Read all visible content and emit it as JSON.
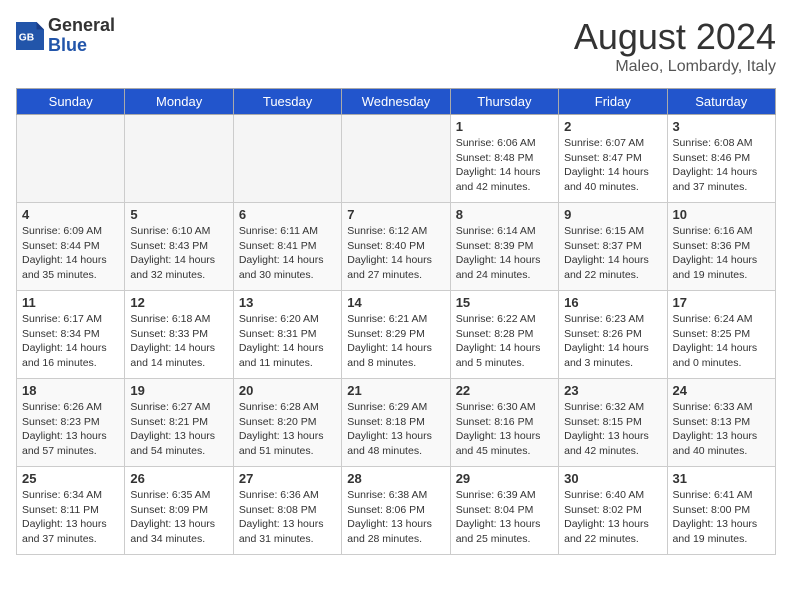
{
  "header": {
    "logo_general": "General",
    "logo_blue": "Blue",
    "month_year": "August 2024",
    "location": "Maleo, Lombardy, Italy"
  },
  "days_of_week": [
    "Sunday",
    "Monday",
    "Tuesday",
    "Wednesday",
    "Thursday",
    "Friday",
    "Saturday"
  ],
  "weeks": [
    [
      {
        "day": "",
        "info": ""
      },
      {
        "day": "",
        "info": ""
      },
      {
        "day": "",
        "info": ""
      },
      {
        "day": "",
        "info": ""
      },
      {
        "day": "1",
        "info": "Sunrise: 6:06 AM\nSunset: 8:48 PM\nDaylight: 14 hours\nand 42 minutes."
      },
      {
        "day": "2",
        "info": "Sunrise: 6:07 AM\nSunset: 8:47 PM\nDaylight: 14 hours\nand 40 minutes."
      },
      {
        "day": "3",
        "info": "Sunrise: 6:08 AM\nSunset: 8:46 PM\nDaylight: 14 hours\nand 37 minutes."
      }
    ],
    [
      {
        "day": "4",
        "info": "Sunrise: 6:09 AM\nSunset: 8:44 PM\nDaylight: 14 hours\nand 35 minutes."
      },
      {
        "day": "5",
        "info": "Sunrise: 6:10 AM\nSunset: 8:43 PM\nDaylight: 14 hours\nand 32 minutes."
      },
      {
        "day": "6",
        "info": "Sunrise: 6:11 AM\nSunset: 8:41 PM\nDaylight: 14 hours\nand 30 minutes."
      },
      {
        "day": "7",
        "info": "Sunrise: 6:12 AM\nSunset: 8:40 PM\nDaylight: 14 hours\nand 27 minutes."
      },
      {
        "day": "8",
        "info": "Sunrise: 6:14 AM\nSunset: 8:39 PM\nDaylight: 14 hours\nand 24 minutes."
      },
      {
        "day": "9",
        "info": "Sunrise: 6:15 AM\nSunset: 8:37 PM\nDaylight: 14 hours\nand 22 minutes."
      },
      {
        "day": "10",
        "info": "Sunrise: 6:16 AM\nSunset: 8:36 PM\nDaylight: 14 hours\nand 19 minutes."
      }
    ],
    [
      {
        "day": "11",
        "info": "Sunrise: 6:17 AM\nSunset: 8:34 PM\nDaylight: 14 hours\nand 16 minutes."
      },
      {
        "day": "12",
        "info": "Sunrise: 6:18 AM\nSunset: 8:33 PM\nDaylight: 14 hours\nand 14 minutes."
      },
      {
        "day": "13",
        "info": "Sunrise: 6:20 AM\nSunset: 8:31 PM\nDaylight: 14 hours\nand 11 minutes."
      },
      {
        "day": "14",
        "info": "Sunrise: 6:21 AM\nSunset: 8:29 PM\nDaylight: 14 hours\nand 8 minutes."
      },
      {
        "day": "15",
        "info": "Sunrise: 6:22 AM\nSunset: 8:28 PM\nDaylight: 14 hours\nand 5 minutes."
      },
      {
        "day": "16",
        "info": "Sunrise: 6:23 AM\nSunset: 8:26 PM\nDaylight: 14 hours\nand 3 minutes."
      },
      {
        "day": "17",
        "info": "Sunrise: 6:24 AM\nSunset: 8:25 PM\nDaylight: 14 hours\nand 0 minutes."
      }
    ],
    [
      {
        "day": "18",
        "info": "Sunrise: 6:26 AM\nSunset: 8:23 PM\nDaylight: 13 hours\nand 57 minutes."
      },
      {
        "day": "19",
        "info": "Sunrise: 6:27 AM\nSunset: 8:21 PM\nDaylight: 13 hours\nand 54 minutes."
      },
      {
        "day": "20",
        "info": "Sunrise: 6:28 AM\nSunset: 8:20 PM\nDaylight: 13 hours\nand 51 minutes."
      },
      {
        "day": "21",
        "info": "Sunrise: 6:29 AM\nSunset: 8:18 PM\nDaylight: 13 hours\nand 48 minutes."
      },
      {
        "day": "22",
        "info": "Sunrise: 6:30 AM\nSunset: 8:16 PM\nDaylight: 13 hours\nand 45 minutes."
      },
      {
        "day": "23",
        "info": "Sunrise: 6:32 AM\nSunset: 8:15 PM\nDaylight: 13 hours\nand 42 minutes."
      },
      {
        "day": "24",
        "info": "Sunrise: 6:33 AM\nSunset: 8:13 PM\nDaylight: 13 hours\nand 40 minutes."
      }
    ],
    [
      {
        "day": "25",
        "info": "Sunrise: 6:34 AM\nSunset: 8:11 PM\nDaylight: 13 hours\nand 37 minutes."
      },
      {
        "day": "26",
        "info": "Sunrise: 6:35 AM\nSunset: 8:09 PM\nDaylight: 13 hours\nand 34 minutes."
      },
      {
        "day": "27",
        "info": "Sunrise: 6:36 AM\nSunset: 8:08 PM\nDaylight: 13 hours\nand 31 minutes."
      },
      {
        "day": "28",
        "info": "Sunrise: 6:38 AM\nSunset: 8:06 PM\nDaylight: 13 hours\nand 28 minutes."
      },
      {
        "day": "29",
        "info": "Sunrise: 6:39 AM\nSunset: 8:04 PM\nDaylight: 13 hours\nand 25 minutes."
      },
      {
        "day": "30",
        "info": "Sunrise: 6:40 AM\nSunset: 8:02 PM\nDaylight: 13 hours\nand 22 minutes."
      },
      {
        "day": "31",
        "info": "Sunrise: 6:41 AM\nSunset: 8:00 PM\nDaylight: 13 hours\nand 19 minutes."
      }
    ]
  ]
}
